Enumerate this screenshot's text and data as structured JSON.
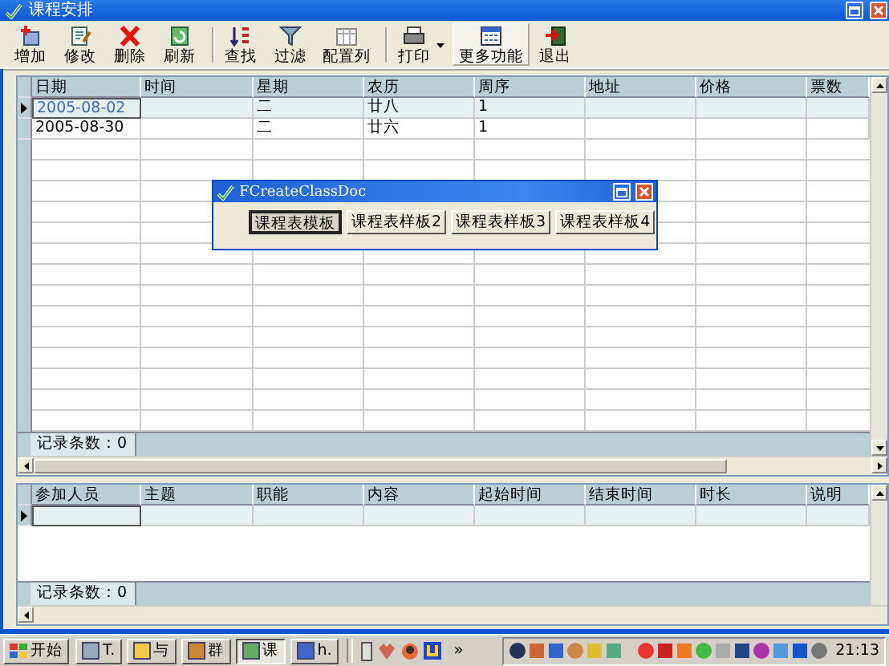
{
  "window": {
    "title": "课程安排"
  },
  "toolbar": [
    {
      "label": "增加",
      "kind": "add",
      "separator_before": false,
      "dropdown": false,
      "hot": false
    },
    {
      "label": "修改",
      "kind": "edit",
      "separator_before": false,
      "dropdown": false,
      "hot": false
    },
    {
      "label": "删除",
      "kind": "delete",
      "separator_before": false,
      "dropdown": false,
      "hot": false
    },
    {
      "label": "刷新",
      "kind": "refresh",
      "separator_before": false,
      "dropdown": false,
      "hot": false
    },
    {
      "label": "查找",
      "kind": "find",
      "separator_before": true,
      "dropdown": false,
      "hot": false
    },
    {
      "label": "过滤",
      "kind": "filter",
      "separator_before": false,
      "dropdown": false,
      "hot": false
    },
    {
      "label": "配置列",
      "kind": "columns",
      "separator_before": false,
      "dropdown": false,
      "hot": false
    },
    {
      "label": "打印",
      "kind": "print",
      "separator_before": true,
      "dropdown": true,
      "hot": false
    },
    {
      "label": "更多功能",
      "kind": "more",
      "separator_before": false,
      "dropdown": false,
      "hot": true
    },
    {
      "label": "退出",
      "kind": "exit",
      "separator_before": false,
      "dropdown": false,
      "hot": false
    }
  ],
  "schedule_table": {
    "columns": [
      "日期",
      "时间",
      "星期",
      "农历",
      "周序",
      "地址",
      "价格",
      "票数"
    ],
    "rows": [
      {
        "cells": [
          "2005-08-02",
          "",
          "二",
          "廿八",
          "1",
          "",
          "",
          ""
        ],
        "current": true
      },
      {
        "cells": [
          "2005-08-30",
          "",
          "二",
          "廿六",
          "1",
          "",
          "",
          ""
        ],
        "current": false
      }
    ],
    "status": "记录条数：0"
  },
  "participants_table": {
    "columns": [
      "参加人员",
      "主题",
      "职能",
      "内容",
      "起始时间",
      "结束时间",
      "时长",
      "说明"
    ],
    "rows": [
      {
        "current": true
      }
    ],
    "status": "记录条数：0"
  },
  "dialog": {
    "title": "FCreateClassDoc",
    "buttons": [
      {
        "label": "课程表模板",
        "pressed": true
      },
      {
        "label": "课程表样板2",
        "pressed": false
      },
      {
        "label": "课程表样板3",
        "pressed": false
      },
      {
        "label": "课程表样板4",
        "pressed": false
      }
    ]
  },
  "taskbar": {
    "start": "开始",
    "tasks": [
      {
        "label": "T.",
        "active": false
      },
      {
        "label": "与",
        "active": false
      },
      {
        "label": "群",
        "active": false
      },
      {
        "label": "课",
        "active": true
      },
      {
        "label": "h.",
        "active": false
      }
    ],
    "overflow": "»",
    "clock": "21:13"
  }
}
